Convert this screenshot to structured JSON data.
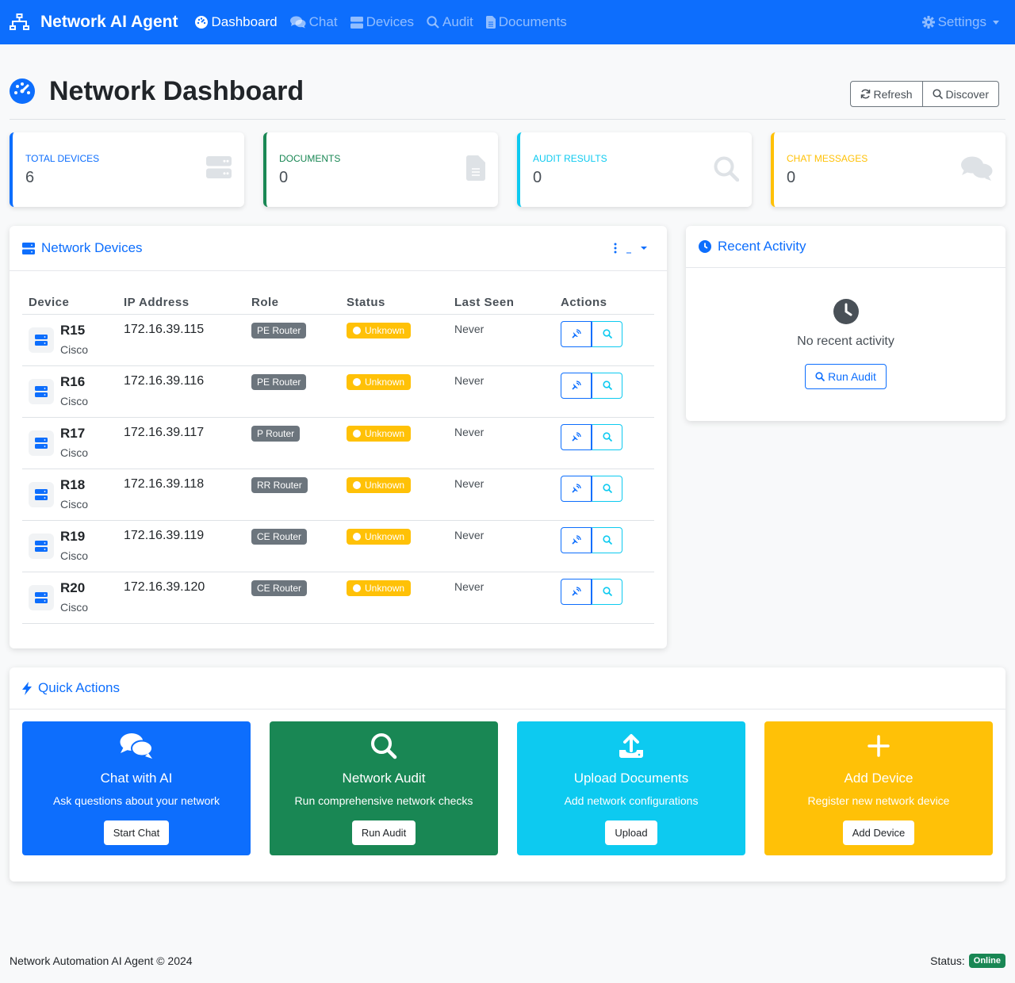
{
  "navbar": {
    "brand": "Network AI Agent",
    "links": [
      {
        "label": "Dashboard",
        "icon": "gauge-icon",
        "active": true
      },
      {
        "label": "Chat",
        "icon": "comments-icon",
        "active": false
      },
      {
        "label": "Devices",
        "icon": "server-icon",
        "active": false
      },
      {
        "label": "Audit",
        "icon": "search-icon",
        "active": false
      },
      {
        "label": "Documents",
        "icon": "file-icon",
        "active": false
      }
    ],
    "settings": "Settings"
  },
  "header": {
    "title": "Network Dashboard",
    "refresh_label": "Refresh",
    "discover_label": "Discover"
  },
  "stats": [
    {
      "label": "Total Devices",
      "value": "6",
      "color": "#0d6efd",
      "icon": "server-icon"
    },
    {
      "label": "Documents",
      "value": "0",
      "color": "#198754",
      "icon": "file-icon"
    },
    {
      "label": "Audit Results",
      "value": "0",
      "color": "#0dcaf0",
      "icon": "search-icon"
    },
    {
      "label": "Chat Messages",
      "value": "0",
      "color": "#ffc107",
      "icon": "comments-icon"
    }
  ],
  "devices_card": {
    "title": "Network Devices",
    "columns": [
      "Device",
      "IP Address",
      "Role",
      "Status",
      "Last Seen",
      "Actions"
    ],
    "rows": [
      {
        "name": "R15",
        "vendor": "Cisco",
        "ip": "172.16.39.115",
        "role": "PE Router",
        "status": "Unknown",
        "last_seen": "Never"
      },
      {
        "name": "R16",
        "vendor": "Cisco",
        "ip": "172.16.39.116",
        "role": "PE Router",
        "status": "Unknown",
        "last_seen": "Never"
      },
      {
        "name": "R17",
        "vendor": "Cisco",
        "ip": "172.16.39.117",
        "role": "P Router",
        "status": "Unknown",
        "last_seen": "Never"
      },
      {
        "name": "R18",
        "vendor": "Cisco",
        "ip": "172.16.39.118",
        "role": "RR Router",
        "status": "Unknown",
        "last_seen": "Never"
      },
      {
        "name": "R19",
        "vendor": "Cisco",
        "ip": "172.16.39.119",
        "role": "CE Router",
        "status": "Unknown",
        "last_seen": "Never"
      },
      {
        "name": "R20",
        "vendor": "Cisco",
        "ip": "172.16.39.120",
        "role": "CE Router",
        "status": "Unknown",
        "last_seen": "Never"
      }
    ]
  },
  "activity_card": {
    "title": "Recent Activity",
    "empty_text": "No recent activity",
    "button_label": "Run Audit"
  },
  "quick_actions": {
    "title": "Quick Actions",
    "tiles": [
      {
        "title": "Chat with AI",
        "description": "Ask questions about your network",
        "button": "Start Chat",
        "color": "#0d6efd",
        "icon": "comments-icon"
      },
      {
        "title": "Network Audit",
        "description": "Run comprehensive network checks",
        "button": "Run Audit",
        "color": "#198754",
        "icon": "search-icon"
      },
      {
        "title": "Upload Documents",
        "description": "Add network configurations",
        "button": "Upload",
        "color": "#0dcaf0",
        "icon": "upload-icon"
      },
      {
        "title": "Add Device",
        "description": "Register new network device",
        "button": "Add Device",
        "color": "#ffc107",
        "icon": "plus-icon"
      }
    ]
  },
  "footer": {
    "copyright": "Network Automation AI Agent © 2024",
    "status_label": "Status:",
    "status_value": "Online"
  }
}
